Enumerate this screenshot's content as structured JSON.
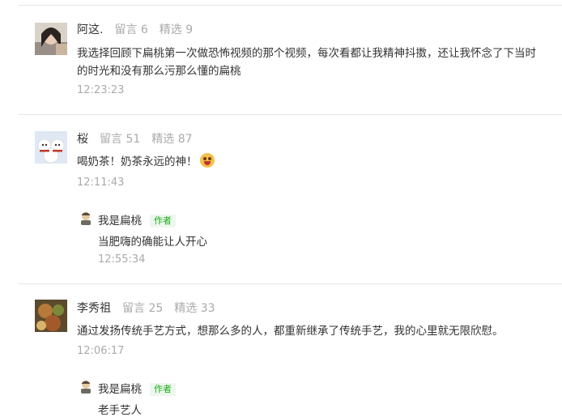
{
  "comments": [
    {
      "name": "阿这.",
      "stats": "留言 6　精选 9",
      "text": "我选择回顾下扁桃第一次做恐怖视频的那个视频，每次看都让我精神抖擞，还让我怀念了下当时的时光和没有那么污那么懂的扁桃",
      "time": "12:23:23"
    },
    {
      "name": "桜",
      "stats": "留言 51　精选 87",
      "text": "喝奶茶！奶茶永远的神！",
      "time": "12:11:43",
      "reply": {
        "name": "我是扁桃",
        "badge": "作者",
        "text": "当肥嗨的确能让人开心",
        "time": "12:55:34"
      }
    },
    {
      "name": "李秀祖",
      "stats": "留言 25　精选 33",
      "text": "通过发扬传统手艺方式，想那么多的人，都重新继承了传统手艺，我的心里就无限欣慰。",
      "time": "12:06:17",
      "reply": {
        "name": "我是扁桃",
        "badge": "作者",
        "text": "老手艺人"
      }
    }
  ],
  "icons": {
    "emoji": "tongue-out-emoji",
    "avatar1": "avatar-portrait",
    "avatar2": "avatar-snowmen",
    "avatar3": "avatar-food",
    "author_avatar": "author-avatar"
  }
}
